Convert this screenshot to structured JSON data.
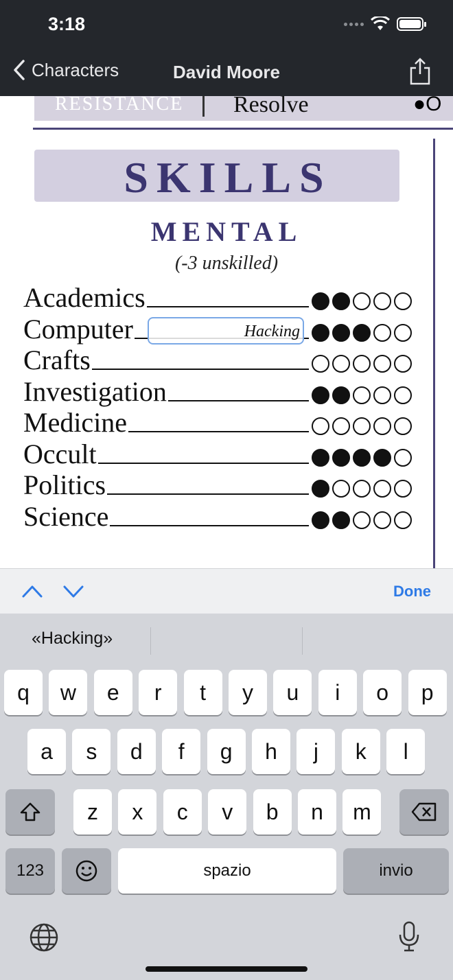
{
  "status_bar": {
    "time": "3:18"
  },
  "nav": {
    "back_label": "Characters",
    "title": "David Moore"
  },
  "sheet": {
    "resistance_label": "RESISTANCE",
    "resistance_value": "Resolve",
    "resistance_dots": "●O",
    "skills_title": "SKILLS",
    "mental_title": "MENTAL",
    "unskilled_note": "(-3 unskilled)",
    "skills": [
      {
        "name": "Academics",
        "dots": 2
      },
      {
        "name": "Computer",
        "dots": 3,
        "specialty": "Hacking"
      },
      {
        "name": "Crafts",
        "dots": 0
      },
      {
        "name": "Investigation",
        "dots": 2
      },
      {
        "name": "Medicine",
        "dots": 0
      },
      {
        "name": "Occult",
        "dots": 4
      },
      {
        "name": "Politics",
        "dots": 1
      },
      {
        "name": "Science",
        "dots": 2
      }
    ]
  },
  "accessory": {
    "done_label": "Done"
  },
  "keyboard": {
    "suggestion": "«Hacking»",
    "row1": [
      "q",
      "w",
      "e",
      "r",
      "t",
      "y",
      "u",
      "i",
      "o",
      "p"
    ],
    "row2": [
      "a",
      "s",
      "d",
      "f",
      "g",
      "h",
      "j",
      "k",
      "l"
    ],
    "row3": [
      "z",
      "x",
      "c",
      "v",
      "b",
      "n",
      "m"
    ],
    "numbers_label": "123",
    "space_label": "spazio",
    "return_label": "invio"
  }
}
